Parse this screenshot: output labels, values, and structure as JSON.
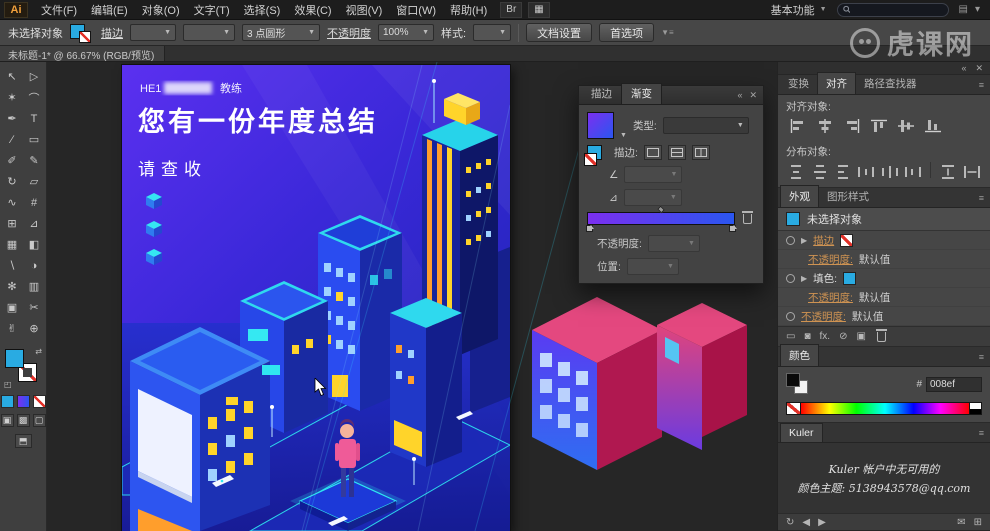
{
  "menu_bar": {
    "app_badge": "Ai",
    "items": [
      "文件(F)",
      "编辑(E)",
      "对象(O)",
      "文字(T)",
      "选择(S)",
      "效果(C)",
      "视图(V)",
      "窗口(W)",
      "帮助(H)"
    ],
    "bridge_badge": "Br",
    "workspace_label": "基本功能",
    "search_value": ""
  },
  "control_bar": {
    "selection_status": "未选择对象",
    "stroke_link": "描边",
    "brush_definition": "3 点圆形",
    "opacity_link": "不透明度",
    "opacity_value": "100%",
    "style_label": "样式:",
    "document_setup_button": "文档设置",
    "preferences_button": "首选项"
  },
  "watermark": {
    "text": "虎课网"
  },
  "document_tab": {
    "title": "未标题-1* @ 66.67% (RGB/预览)"
  },
  "toolbar": {
    "tools": [
      {
        "name": "selection-tool",
        "glyph": "↖"
      },
      {
        "name": "direct-selection-tool",
        "glyph": "▷"
      },
      {
        "name": "magic-wand-tool",
        "glyph": "✶"
      },
      {
        "name": "lasso-tool",
        "glyph": "⌒"
      },
      {
        "name": "pen-tool",
        "glyph": "✒"
      },
      {
        "name": "type-tool",
        "glyph": "T"
      },
      {
        "name": "line-segment-tool",
        "glyph": "∕"
      },
      {
        "name": "rectangle-tool",
        "glyph": "▭"
      },
      {
        "name": "paintbrush-tool",
        "glyph": "✐"
      },
      {
        "name": "pencil-tool",
        "glyph": "✎"
      },
      {
        "name": "rotate-tool",
        "glyph": "↻"
      },
      {
        "name": "scale-tool",
        "glyph": "▱"
      },
      {
        "name": "width-tool",
        "glyph": "∿"
      },
      {
        "name": "free-transform-tool",
        "glyph": "#"
      },
      {
        "name": "shape-builder-tool",
        "glyph": "⊞"
      },
      {
        "name": "perspective-grid-tool",
        "glyph": "⊿"
      },
      {
        "name": "mesh-tool",
        "glyph": "▦"
      },
      {
        "name": "gradient-tool",
        "glyph": "◧"
      },
      {
        "name": "eyedropper-tool",
        "glyph": "∖"
      },
      {
        "name": "blend-tool",
        "glyph": "◑"
      },
      {
        "name": "symbol-sprayer-tool",
        "glyph": "✻"
      },
      {
        "name": "column-graph-tool",
        "glyph": "▥"
      },
      {
        "name": "artboard-tool",
        "glyph": "▣"
      },
      {
        "name": "slice-tool",
        "glyph": "✂"
      },
      {
        "name": "hand-tool",
        "glyph": "✌"
      },
      {
        "name": "zoom-tool",
        "glyph": "⊕"
      }
    ]
  },
  "poster": {
    "top_line_left": "HE1",
    "top_line_right": "教练",
    "title": "您有一份年度总结",
    "subtitle": "请查收"
  },
  "gradient_panel": {
    "tab_stroke": "描边",
    "tab_gradient": "渐变",
    "type_label": "类型:",
    "stroke_label": "描边:",
    "opacity_label": "不透明度:",
    "location_label": "位置:",
    "gradient_start": "#7b2ff0",
    "gradient_end": "#2a56f0"
  },
  "align_panel": {
    "tabs": [
      "变换",
      "对齐",
      "路径查找器"
    ],
    "align_objects_label": "对齐对象:",
    "distribute_objects_label": "分布对象:"
  },
  "appearance_panel": {
    "tabs": [
      "外观",
      "图形样式"
    ],
    "selection_title": "未选择对象",
    "rows": [
      {
        "label": "描边",
        "value": ""
      },
      {
        "label": "不透明度:",
        "value": "默认值"
      },
      {
        "label": "填色:",
        "value": ""
      },
      {
        "label": "不透明度:",
        "value": "默认值"
      },
      {
        "label": "不透明度:",
        "value": "默认值"
      }
    ],
    "fx_label": "fx."
  },
  "color_panel": {
    "tab": "颜色",
    "hex_prefix": "#",
    "hex_value": "008ef"
  },
  "kuler_panel": {
    "tab": "Kuler",
    "message_line1": "Kuler 帐户中无可用的",
    "message_line2": "颜色主题: 5138943578@qq.com"
  },
  "colors": {
    "ui_fill_blue": "#29abe2",
    "poster_bg_top": "#5b30f0",
    "poster_bg_bottom": "#1b24b2",
    "pink_shape": "#d63b74",
    "accent_cyan": "#2fe7f2",
    "accent_yellow": "#ffd42a",
    "accent_orange": "#ff9e2c"
  }
}
